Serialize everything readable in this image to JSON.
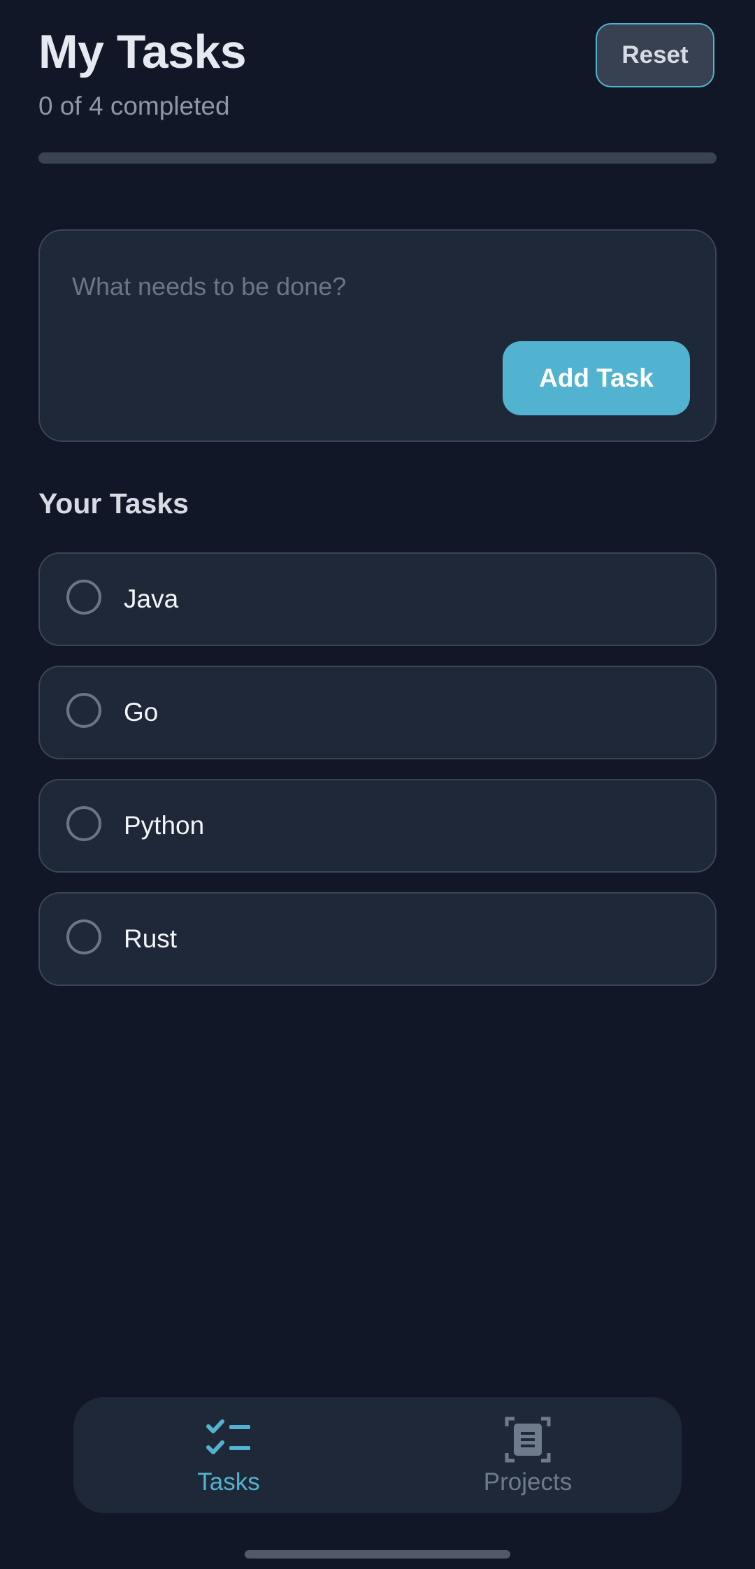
{
  "header": {
    "title": "My Tasks",
    "progress_text": "0 of 4 completed",
    "reset_label": "Reset",
    "progress_fraction": 0.0
  },
  "composer": {
    "placeholder": "What needs to be done?",
    "value": "",
    "add_label": "Add Task"
  },
  "tasks_section": {
    "heading": "Your Tasks",
    "items": [
      {
        "label": "Java",
        "completed": false
      },
      {
        "label": "Go",
        "completed": false
      },
      {
        "label": "Python",
        "completed": false
      },
      {
        "label": "Rust",
        "completed": false
      }
    ]
  },
  "bottom_nav": {
    "items": [
      {
        "label": "Tasks",
        "icon": "checklist-icon",
        "active": true
      },
      {
        "label": "Projects",
        "icon": "document-icon",
        "active": false
      }
    ]
  },
  "colors": {
    "background": "#111727",
    "card": "#1f2838",
    "accent": "#52b3d0",
    "muted": "#6b7587"
  }
}
